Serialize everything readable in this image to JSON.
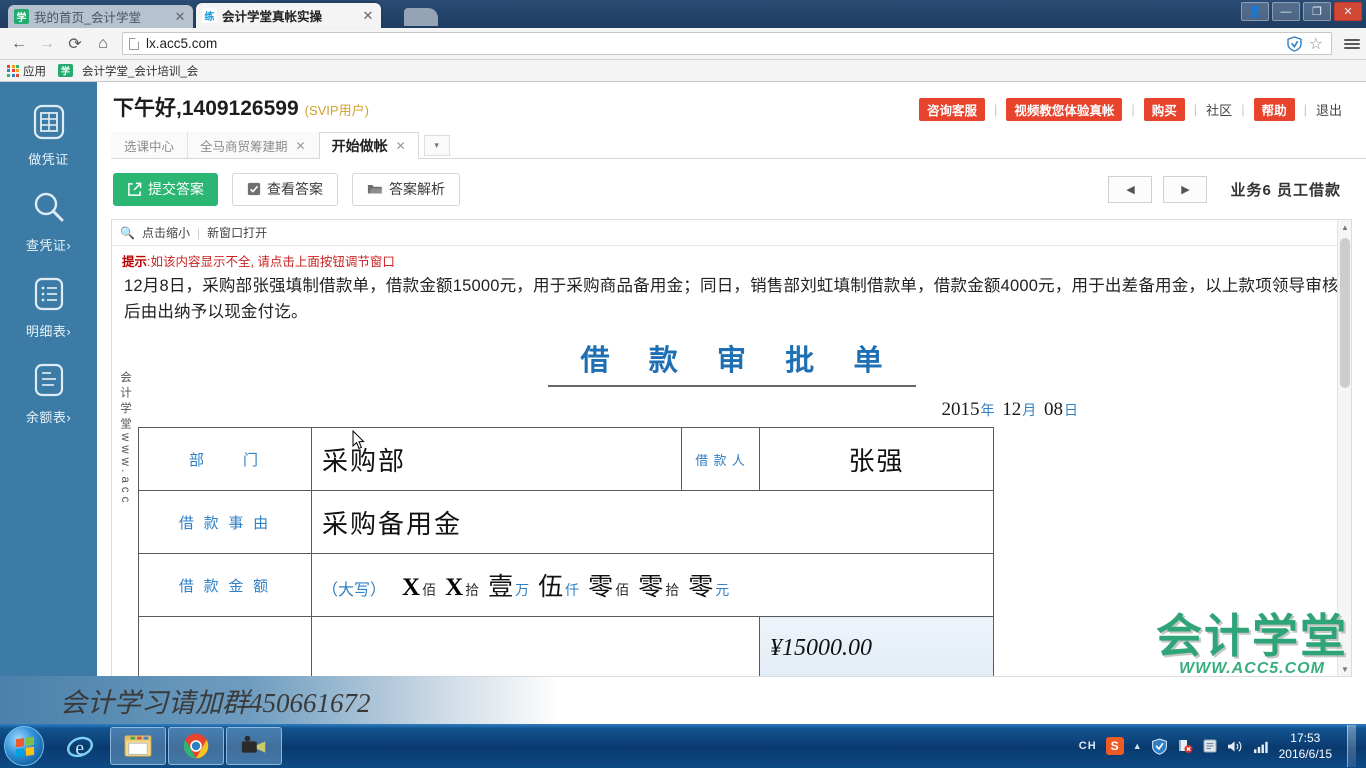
{
  "browser": {
    "tabs": [
      {
        "title": "我的首页_会计学堂",
        "favicon": "学",
        "active": false
      },
      {
        "title": "会计学堂真帐实操",
        "favicon": "练",
        "active": true
      }
    ],
    "url": "lx.acc5.com",
    "nav": {
      "back": "◀",
      "forward": "▶",
      "reload": "⟳",
      "home": "⌂"
    },
    "omni_icons": {
      "shield": "shield-icon",
      "star": "☆",
      "menu": "menu-icon"
    },
    "bookmarks": [
      {
        "label": "应用",
        "icon": "apps-grid-icon"
      },
      {
        "label": "会计学堂_会计培训_会",
        "icon": "学"
      }
    ],
    "window_controls": {
      "user": "👤",
      "minimize": "—",
      "maximize": "❐",
      "close": "✕"
    }
  },
  "sidebar": {
    "items": [
      {
        "label": "做凭证",
        "icon": "voucher-icon",
        "chevron": ""
      },
      {
        "label": "查凭证",
        "icon": "search-icon",
        "chevron": "›"
      },
      {
        "label": "明细表",
        "icon": "detail-list-icon",
        "chevron": "›"
      },
      {
        "label": "余额表",
        "icon": "balance-list-icon",
        "chevron": "›"
      }
    ]
  },
  "header": {
    "greeting": "下午好,1409126599",
    "vip_tag": "(SVIP用户)",
    "nav": [
      {
        "label": "咨询客服",
        "style": "red"
      },
      {
        "label": "视频教您体验真帐",
        "style": "red"
      },
      {
        "label": "购买",
        "style": "red"
      },
      {
        "label": "社区",
        "style": "plain"
      },
      {
        "label": "帮助",
        "style": "red"
      },
      {
        "label": "退出",
        "style": "plain"
      }
    ]
  },
  "subtabs": [
    {
      "label": "选课中心",
      "closable": false,
      "active": false
    },
    {
      "label": "全马商贸筹建期",
      "closable": true,
      "active": false
    },
    {
      "label": "开始做帐",
      "closable": true,
      "active": true
    }
  ],
  "subtabs_more": "▾",
  "actions": {
    "submit": "提交答案",
    "view_answer": "查看答案",
    "analysis": "答案解析",
    "prev": "◀",
    "next": "▶",
    "business_title": "业务6 员工借款"
  },
  "panel": {
    "zoom_out": "点击缩小",
    "separator": "|",
    "new_window": "新窗口打开",
    "hint_label": "提示",
    "hint_text": ":如该内容显示不全, 请点击上面按钮调节窗口",
    "description": "12月8日，采购部张强填制借款单，借款金额15000元，用于采购商品备用金；同日，销售部刘虹填制借款单，借款金额4000元，用于出差备用金，以上款项领导审核后由出纳予以现金付讫。"
  },
  "document": {
    "title": "借 款 审 批 单",
    "date": {
      "year": "2015",
      "year_unit": "年",
      "month": "12",
      "month_unit": "月",
      "day": "08",
      "day_unit": "日"
    },
    "vertical_watermark": "会计学堂www.acc",
    "rows": {
      "dept_label": "部　　门",
      "dept_value": "采购部",
      "borrower_label": "借 款 人",
      "borrower_value": "张强",
      "reason_label": "借 款 事 由",
      "reason_value": "采购备用金",
      "amount_label": "借 款 金 额",
      "amount_caps_label": "（大写）",
      "amount_caps": [
        {
          "digit": "X",
          "unit": "佰"
        },
        {
          "digit": "X",
          "unit": "拾"
        },
        {
          "digit": "壹",
          "unit": "万"
        },
        {
          "digit": "伍",
          "unit": "仟"
        },
        {
          "digit": "零",
          "unit": "佰"
        },
        {
          "digit": "零",
          "unit": "拾"
        },
        {
          "digit": "零",
          "unit": "元"
        }
      ],
      "amount_figures": "¥15000.00"
    }
  },
  "watermarks": {
    "logo_main": "会计学堂",
    "logo_url": "WWW.ACC5.COM",
    "bottom_banner": "会计学习请加群450661672"
  },
  "taskbar": {
    "start": "start-orb",
    "items": [
      {
        "icon": "internet-explorer-icon",
        "pinned": false
      },
      {
        "icon": "file-explorer-icon",
        "pinned": true
      },
      {
        "icon": "chrome-icon",
        "pinned": true
      },
      {
        "icon": "camera-recorder-icon",
        "pinned": true
      }
    ],
    "tray": {
      "ime": "CH",
      "sogou": "S",
      "arrow": "▲",
      "icons": [
        "shield-icon",
        "network-error-icon",
        "action-center-icon",
        "volume-icon",
        "signal-icon"
      ],
      "time": "17:53",
      "date": "2016/6/15"
    }
  },
  "colors": {
    "sidebar": "#3b7ba5",
    "accent_green": "#2bb673",
    "accent_red": "#e8432d",
    "doc_blue": "#2f7fc4"
  }
}
